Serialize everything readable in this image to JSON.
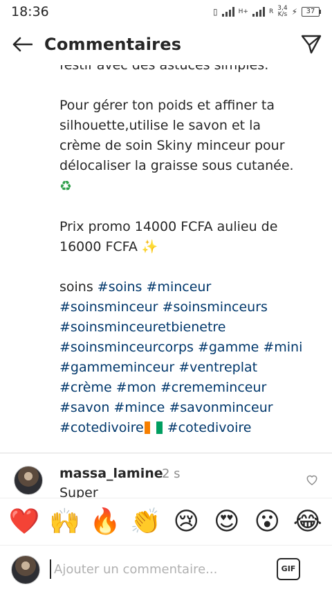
{
  "status_bar": {
    "time": "18:36",
    "network_type": "H+",
    "network_type_2": "R",
    "net_speed_value": "3,4",
    "net_speed_unit": "K/s",
    "battery": "37"
  },
  "header": {
    "title": "Commentaires",
    "back_icon": "arrow-left-icon",
    "send_icon": "paper-plane-icon"
  },
  "caption": {
    "cut_line": "festif avec des astuces simples.",
    "para1": {
      "l1": "Pour gérer ton poids et affiner ta",
      "l2": "silhouette,utilise le savon et la",
      "l3": "crème de soin Skiny minceur pour",
      "l4": "délocaliser la graisse sous cutanée.",
      "emoji": "♻"
    },
    "para2": {
      "l1": "Prix promo 14000 FCFA aulieu de",
      "l2": "16000 FCFA",
      "emoji": "✨"
    },
    "tags": {
      "plain": "soins",
      "t1": "#soins",
      "t2": "#minceur",
      "t3": "#soinsminceur",
      "t4": "#soinsminceurs",
      "t5": "#soinsminceuretbienetre",
      "t6": "#soinsminceurcorps",
      "t7": "#gamme",
      "t8": "#mini",
      "t9": "#gammeminceur",
      "t10": "#ventreplat",
      "t11": "#crème",
      "t12": "#mon",
      "t13": "#crememinceur",
      "t14": "#savon",
      "t15": "#mince",
      "t16": "#savonminceur",
      "t17": "#cotedivoire",
      "t18": "#cotedivoire"
    },
    "flag_colors": [
      "#f77f00",
      "#ffffff",
      "#009e60"
    ]
  },
  "comment": {
    "username": "massa_lamine",
    "time": "2 s",
    "text": "Super",
    "like_icon": "heart-outline-icon"
  },
  "emoji_bar": [
    "❤️",
    "🙌",
    "🔥",
    "👏",
    "😢",
    "😍",
    "😮",
    "😂"
  ],
  "comment_input": {
    "placeholder": "Ajouter un commentaire...",
    "gif_label": "GIF"
  }
}
